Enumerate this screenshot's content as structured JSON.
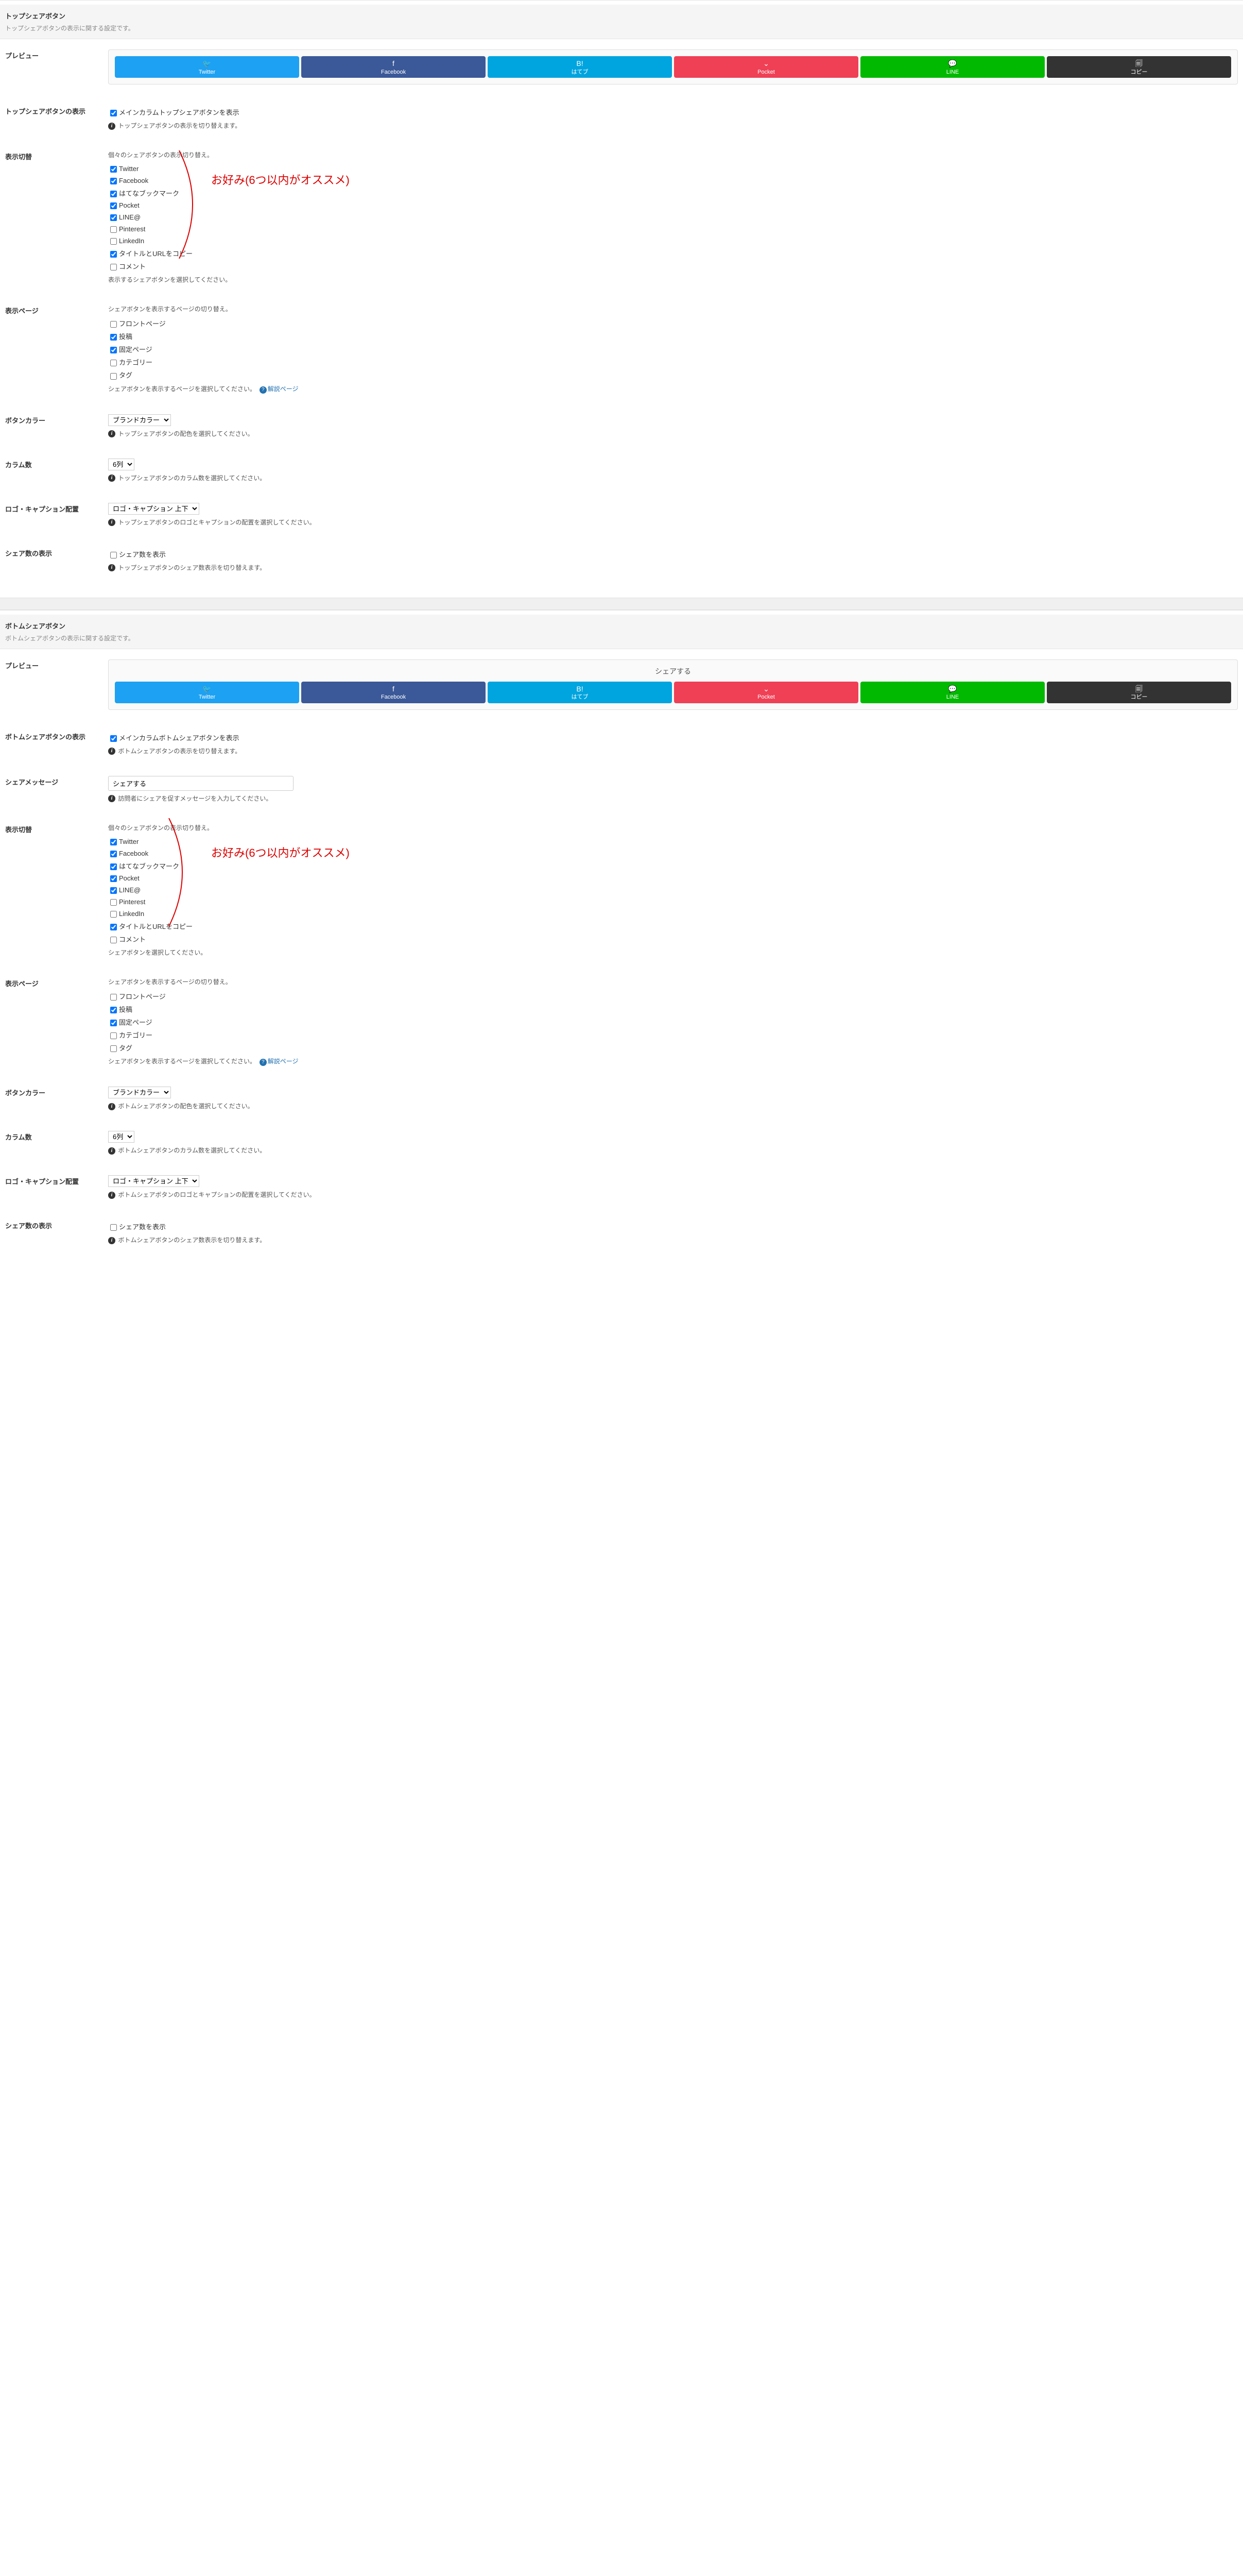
{
  "annotation": "お好み(6つ以内がオススメ)",
  "top": {
    "title": "トップシェアボタン",
    "desc": "トップシェアボタンの表示に関する設定です。",
    "preview_label": "プレビュー",
    "buttons": {
      "twitter": "Twitter",
      "facebook": "Facebook",
      "hatena": "はてブ",
      "pocket": "Pocket",
      "line": "LINE",
      "copy": "コピー"
    },
    "display": {
      "label": "トップシェアボタンの表示",
      "cb": "メインカラムトップシェアボタンを表示",
      "hint": "トップシェアボタンの表示を切り替えます。"
    },
    "toggle": {
      "label": "表示切替",
      "desc": "個々のシェアボタンの表示切り替え。",
      "items": {
        "twitter": "Twitter",
        "facebook": "Facebook",
        "hatena": "はてなブックマーク",
        "pocket": "Pocket",
        "line": "LINE@",
        "pinterest": "Pinterest",
        "linkedin": "LinkedIn",
        "copy": "タイトルとURLをコピー",
        "comment": "コメント"
      },
      "hint": "表示するシェアボタンを選択してください。"
    },
    "pages": {
      "label": "表示ページ",
      "desc": "シェアボタンを表示するページの切り替え。",
      "items": {
        "front": "フロントページ",
        "post": "投稿",
        "page": "固定ページ",
        "category": "カテゴリー",
        "tag": "タグ"
      },
      "hint": "シェアボタンを表示するページを選択してください。",
      "help": "解説ページ"
    },
    "color": {
      "label": "ボタンカラー",
      "value": "ブランドカラー",
      "hint": "トップシェアボタンの配色を選択してください。"
    },
    "columns": {
      "label": "カラム数",
      "value": "6列",
      "hint": "トップシェアボタンのカラム数を選択してください。"
    },
    "logo": {
      "label": "ロゴ・キャプション配置",
      "value": "ロゴ・キャプション 上下",
      "hint": "トップシェアボタンのロゴとキャプションの配置を選択してください。"
    },
    "count": {
      "label": "シェア数の表示",
      "cb": "シェア数を表示",
      "hint": "トップシェアボタンのシェア数表示を切り替えます。"
    }
  },
  "bottom": {
    "title": "ボトムシェアボタン",
    "desc": "ボトムシェアボタンの表示に関する設定です。",
    "preview_label": "プレビュー",
    "share_heading": "シェアする",
    "buttons": {
      "twitter": "Twitter",
      "facebook": "Facebook",
      "hatena": "はてブ",
      "pocket": "Pocket",
      "line": "LINE",
      "copy": "コピー"
    },
    "display": {
      "label": "ボトムシェアボタンの表示",
      "cb": "メインカラムボトムシェアボタンを表示",
      "hint": "ボトムシェアボタンの表示を切り替えます。"
    },
    "message": {
      "label": "シェアメッセージ",
      "value": "シェアする",
      "hint": "訪問者にシェアを促すメッセージを入力してください。"
    },
    "toggle": {
      "label": "表示切替",
      "desc": "個々のシェアボタンの表示切り替え。",
      "items": {
        "twitter": "Twitter",
        "facebook": "Facebook",
        "hatena": "はてなブックマーク",
        "pocket": "Pocket",
        "line": "LINE@",
        "pinterest": "Pinterest",
        "linkedin": "LinkedIn",
        "copy": "タイトルとURLをコピー",
        "comment": "コメント"
      },
      "hint": "シェアボタンを選択してください。"
    },
    "pages": {
      "label": "表示ページ",
      "desc": "シェアボタンを表示するページの切り替え。",
      "items": {
        "front": "フロントページ",
        "post": "投稿",
        "page": "固定ページ",
        "category": "カテゴリー",
        "tag": "タグ"
      },
      "hint": "シェアボタンを表示するページを選択してください。",
      "help": "解説ページ"
    },
    "color": {
      "label": "ボタンカラー",
      "value": "ブランドカラー",
      "hint": "ボトムシェアボタンの配色を選択してください。"
    },
    "columns": {
      "label": "カラム数",
      "value": "6列",
      "hint": "ボトムシェアボタンのカラム数を選択してください。"
    },
    "logo": {
      "label": "ロゴ・キャプション配置",
      "value": "ロゴ・キャプション 上下",
      "hint": "ボトムシェアボタンのロゴとキャプションの配置を選択してください。"
    },
    "count": {
      "label": "シェア数の表示",
      "cb": "シェア数を表示",
      "hint": "ボトムシェアボタンのシェア数表示を切り替えます。"
    }
  }
}
